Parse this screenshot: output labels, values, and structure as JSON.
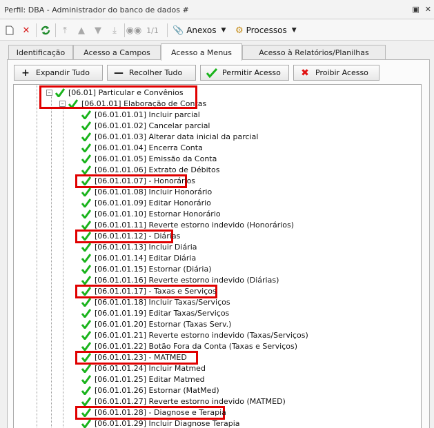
{
  "window": {
    "title": "Perfil: DBA - Administrador do banco de dados #",
    "controls": [
      "pin-icon",
      "close-icon"
    ]
  },
  "toolbar": {
    "page_indicator": "1/1",
    "anexos_label": "Anexos",
    "processos_label": "Processos"
  },
  "tabs": [
    {
      "label": "Identificação"
    },
    {
      "label": "Acesso a Campos"
    },
    {
      "label": "Acesso a Menus"
    },
    {
      "label": "Acesso à Relatórios/Planilhas"
    }
  ],
  "actions": {
    "expand_label": "Expandir Tudo",
    "collapse_label": "Recolher Tudo",
    "allow_label": "Permitir Acesso",
    "deny_label": "Proibir Acesso"
  },
  "tree": {
    "root": "[06.01] Particular e Convênios",
    "group": "[06.01.01] Elaboração de Contas",
    "items": [
      "[06.01.01.01] Incluir parcial",
      "[06.01.01.02] Cancelar parcial",
      "[06.01.01.03] Alterar data inicial da parcial",
      "[06.01.01.04] Encerra Conta",
      "[06.01.01.05] Emissão da Conta",
      "[06.01.01.06] Extrato de Débitos",
      "[06.01.01.07] - Honorários",
      "[06.01.01.08] Incluir Honorário",
      "[06.01.01.09] Editar Honorário",
      "[06.01.01.10] Estornar Honorário",
      "[06.01.01.11] Reverte estorno indevido (Honorários)",
      "[06.01.01.12] - Diárias",
      "[06.01.01.13] Incluir Diária",
      "[06.01.01.14] Editar Diária",
      "[06.01.01.15] Estornar (Diária)",
      "[06.01.01.16] Reverte estorno indevido (Diárias)",
      "[06.01.01.17] - Taxas e Serviços",
      "[06.01.01.18] Incluir Taxas/Serviços",
      "[06.01.01.19] Editar Taxas/Serviços",
      "[06.01.01.20] Estornar (Taxas Serv.)",
      "[06.01.01.21] Reverte estorno indevido (Taxas/Serviços)",
      "[06.01.01.22] Botão Fora da Conta (Taxas e Serviços)",
      "[06.01.01.23] - MATMED",
      "[06.01.01.24] Incluir Matmed",
      "[06.01.01.25] Editar Matmed",
      "[06.01.01.26] Estornar (MatMed)",
      "[06.01.01.27] Reverte estorno indevido (MATMED)",
      "[06.01.01.28] - Diagnose e Terapia",
      "[06.01.01.29] Incluir Diagnose Terapia"
    ]
  },
  "colors": {
    "check": "#19b31b",
    "highlight": "#e00000",
    "deny": "#e01010"
  }
}
